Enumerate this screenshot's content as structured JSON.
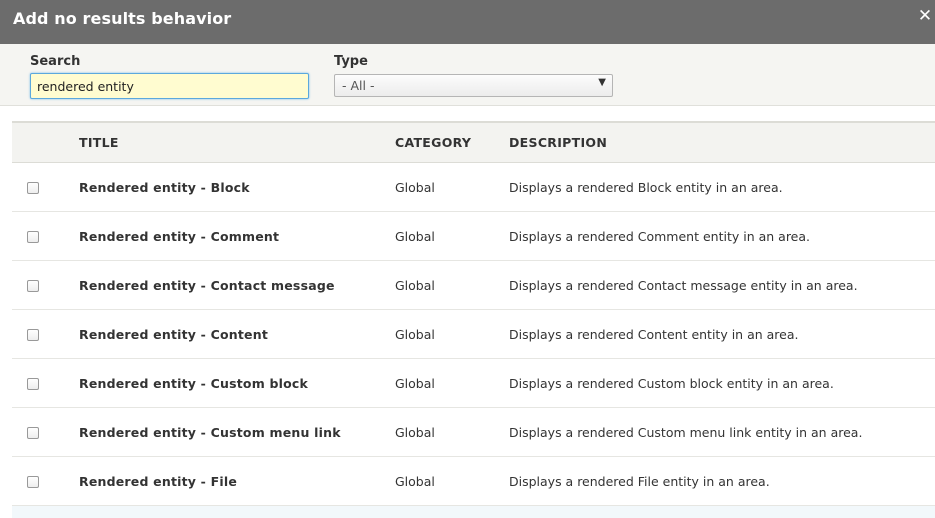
{
  "dialog": {
    "title": "Add no results behavior",
    "close_label": "✕"
  },
  "filters": {
    "search_label": "Search",
    "search_value": "rendered entity",
    "type_label": "Type",
    "type_value": "- All -"
  },
  "table": {
    "headers": {
      "title": "TITLE",
      "category": "CATEGORY",
      "description": "DESCRIPTION"
    },
    "rows": [
      {
        "title": "Rendered entity - Block",
        "category": "Global",
        "description": "Displays a rendered Block entity in an area."
      },
      {
        "title": "Rendered entity - Comment",
        "category": "Global",
        "description": "Displays a rendered Comment entity in an area."
      },
      {
        "title": "Rendered entity - Contact message",
        "category": "Global",
        "description": "Displays a rendered Contact message entity in an area."
      },
      {
        "title": "Rendered entity - Content",
        "category": "Global",
        "description": "Displays a rendered Content entity in an area."
      },
      {
        "title": "Rendered entity - Custom block",
        "category": "Global",
        "description": "Displays a rendered Custom block entity in an area."
      },
      {
        "title": "Rendered entity - Custom menu link",
        "category": "Global",
        "description": "Displays a rendered Custom menu link entity in an area."
      },
      {
        "title": "Rendered entity - File",
        "category": "Global",
        "description": "Displays a rendered File entity in an area."
      }
    ]
  }
}
